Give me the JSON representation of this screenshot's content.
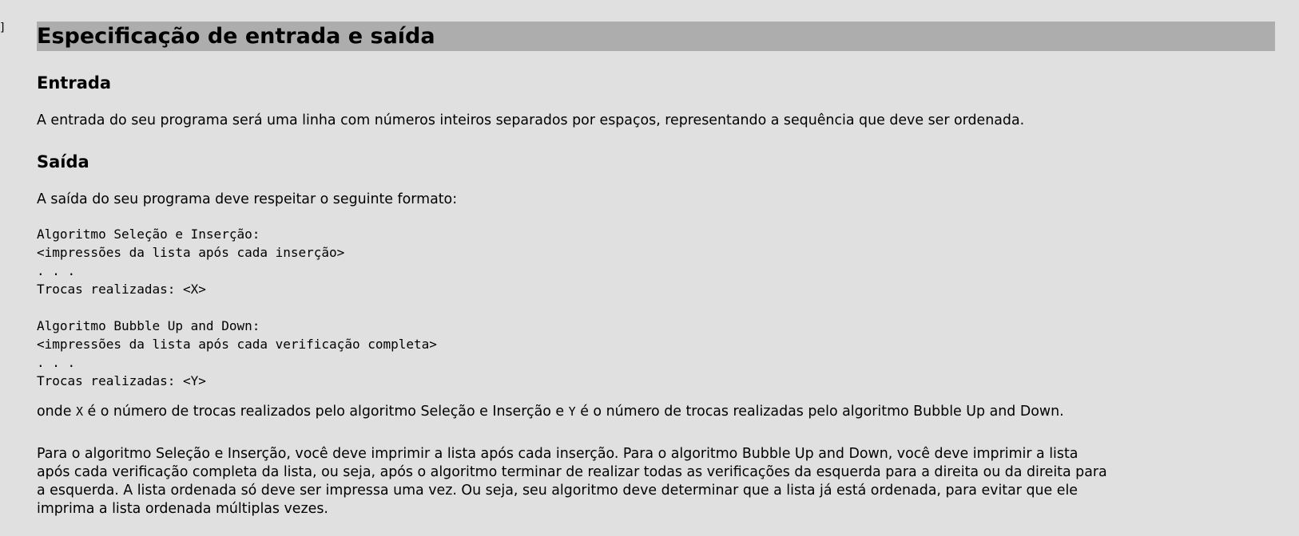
{
  "edge_mark": "]",
  "doc": {
    "title": "Especificação de entrada e saída",
    "input_section": {
      "heading": "Entrada",
      "text": "A entrada do seu programa será uma linha com números inteiros separados por espaços, representando a sequência que deve ser ordenada."
    },
    "output_section": {
      "heading": "Saída",
      "intro": "A saída do seu programa deve respeitar o seguinte formato:",
      "format_lines": [
        "Algoritmo Seleção e Inserção:",
        "<impressões da lista após cada inserção>",
        ". . .",
        "Trocas realizadas: <X>",
        "",
        "Algoritmo Bubble Up and Down:",
        "<impressões da lista após cada verificação completa>",
        ". . .",
        "Trocas realizadas: <Y>"
      ],
      "where_part1": "onde ",
      "where_var_x": "X",
      "where_part2": " é o número de trocas realizados pelo algoritmo Seleção e Inserção e ",
      "where_var_y": "Y",
      "where_part3": " é o número de trocas realizadas pelo algoritmo Bubble Up and Down.",
      "details_lines": [
        "Para o algoritmo Seleção e Inserção, você deve imprimir a lista após cada inserção. Para o algoritmo Bubble Up and Down, você deve imprimir a lista",
        "após cada verificação completa da lista, ou seja, após o algoritmo terminar de realizar todas as verificações da esquerda para a direita ou da direita para",
        "a esquerda. A lista ordenada só deve ser impressa uma vez. Ou seja, seu algoritmo deve determinar que a lista já está ordenada, para evitar que ele",
        "imprima a lista ordenada múltiplas vezes."
      ]
    }
  },
  "colors": {
    "background": "#e0e0e0",
    "title_bar": "#adadad",
    "text": "#000000"
  }
}
